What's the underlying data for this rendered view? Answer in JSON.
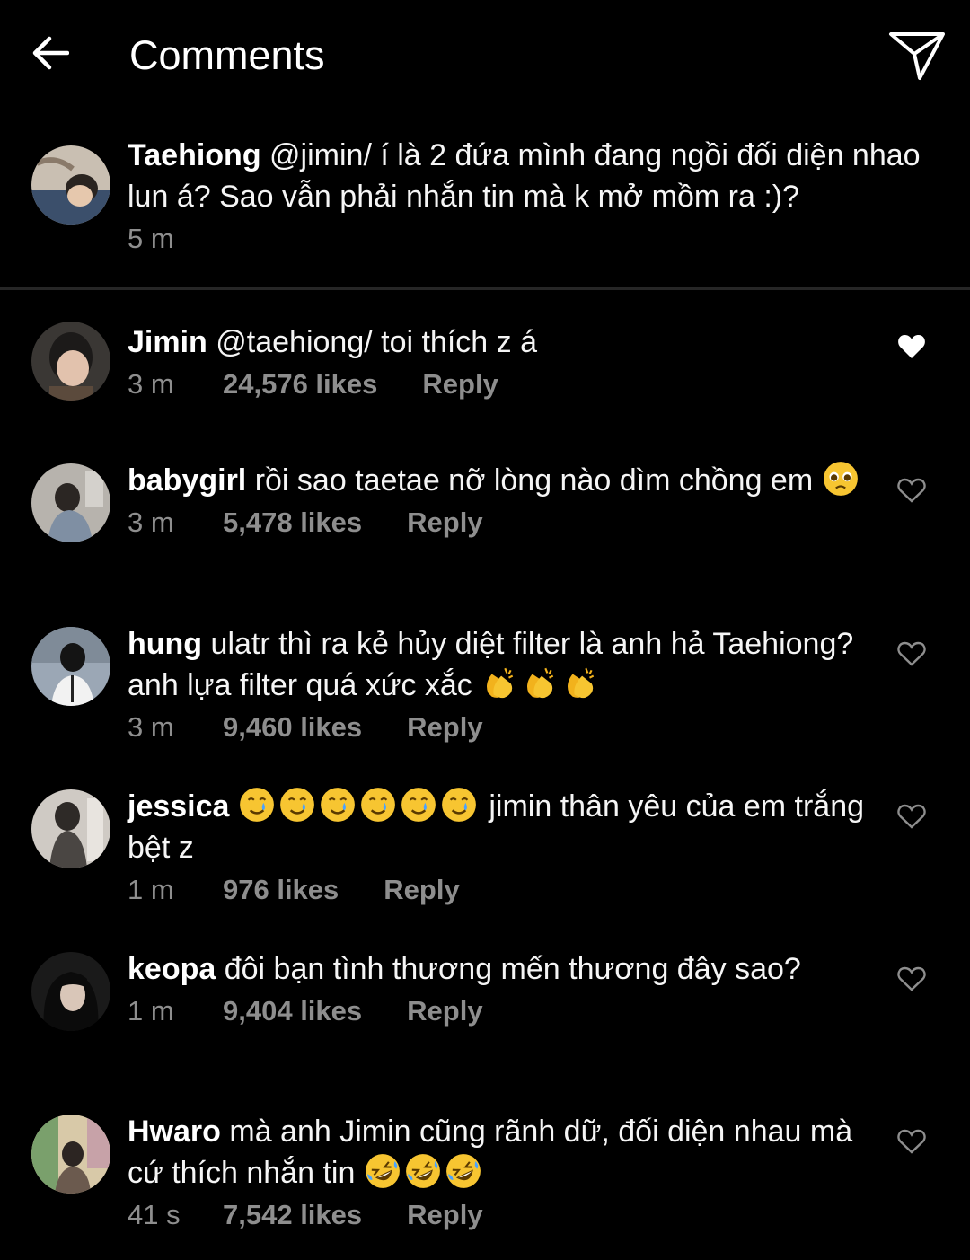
{
  "header": {
    "title": "Comments",
    "back_icon": "arrow-left-icon",
    "share_icon": "paper-plane-icon"
  },
  "caption": {
    "username": "Taehiong",
    "text": "@jimin/ í là 2 đứa mình đang ngồi đối diện nhao lun á? Sao vẫn phải nhắn tin mà k mở mồm ra :)?",
    "time": "5 m"
  },
  "comments": [
    {
      "username": "Jimin",
      "text": "@taehiong/ toi thích z á",
      "time": "3 m",
      "likes": "24,576 likes",
      "reply": "Reply",
      "liked": true,
      "emoji": "",
      "text_after": ""
    },
    {
      "username": "babygirl",
      "text": "rồi sao taetae nỡ lòng nào dìm chồng em",
      "time": "3 m",
      "likes": "5,478 likes",
      "reply": "Reply",
      "liked": false,
      "emoji": "pleading-face-emoji",
      "text_after": ""
    },
    {
      "username": "hung",
      "text": "ulatr thì ra kẻ hủy diệt filter là anh hả Taehiong? anh lựa filter quá xức xắc",
      "time": "3 m",
      "likes": "9,460 likes",
      "reply": "Reply",
      "liked": false,
      "emoji": "clapping-hands-emoji",
      "text_after": ""
    },
    {
      "username": "jessica",
      "text": "",
      "time": "1 m",
      "likes": "976 likes",
      "reply": "Reply",
      "liked": false,
      "emoji": "smiling-face-with-tear-emoji",
      "text_after": "jimin thân yêu của em trắng bệt z"
    },
    {
      "username": "keopa",
      "text": "đôi bạn tình thương mến thương đây sao?",
      "time": "1 m",
      "likes": "9,404 likes",
      "reply": "Reply",
      "liked": false,
      "emoji": "",
      "text_after": ""
    },
    {
      "username": "Hwaro",
      "text": "mà anh Jimin cũng rãnh dữ, đối diện nhau mà cứ thích nhắn tin",
      "time": "41 s",
      "likes": "7,542 likes",
      "reply": "Reply",
      "liked": false,
      "emoji": "rolling-on-floor-laughing-emoji",
      "text_after": ""
    }
  ],
  "colors": {
    "background": "#000000",
    "text": "#ffffff",
    "secondary_text": "#8e8e8e",
    "divider": "#262626",
    "emoji_yellow": "#f7c531"
  }
}
